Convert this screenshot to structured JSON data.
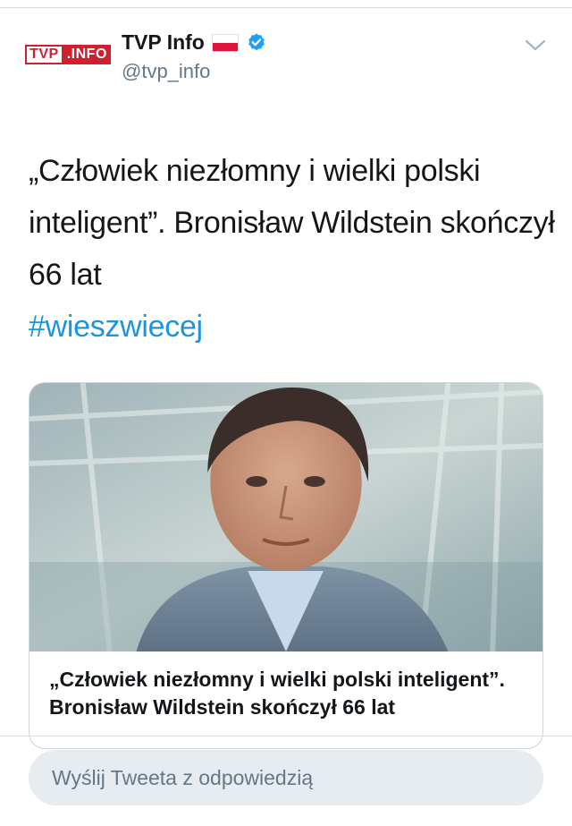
{
  "tweet": {
    "author": {
      "display_name": "TVP Info",
      "handle": "@tvp_info",
      "verified": true,
      "flag_icon": "poland-flag-icon",
      "avatar": {
        "logo_left": "TVP",
        "logo_right": ".INFO"
      }
    },
    "text": "„Człowiek niezłomny i wielki polski inteligent”. Bronisław Wildstein skończył 66 lat",
    "hashtag": "#wieszwiecej",
    "card": {
      "title": "„Człowiek niezłomny i wielki polski inteligent”. Bronisław Wildstein skończył 66 lat"
    }
  },
  "reply": {
    "placeholder": "Wyślij Tweeta z odpowiedzią"
  },
  "colors": {
    "link": "#1b95e0",
    "text": "#14171a",
    "secondary": "#657786",
    "border": "#ccd6dd",
    "reply_bg": "#e6ecf0",
    "brand_red": "#d11f2f",
    "verified_blue": "#1da1f2"
  }
}
